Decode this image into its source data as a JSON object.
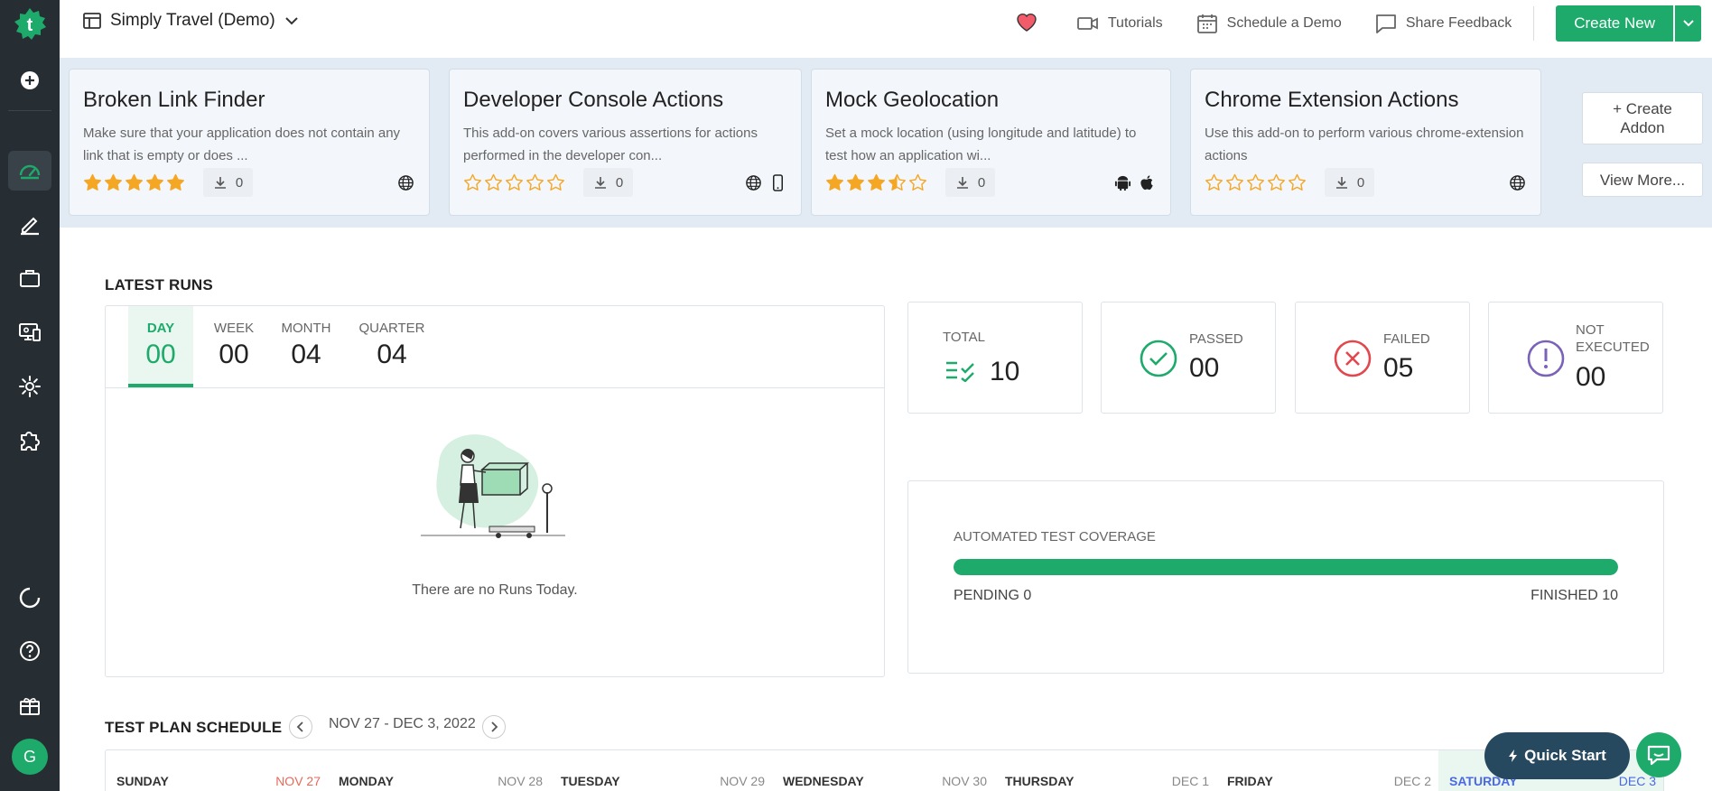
{
  "colors": {
    "brand": "#1eaa6b",
    "sidebar": "#262d33",
    "star": "#f5a623",
    "failed": "#e2474e",
    "not_executed": "#7a62b8",
    "quick_start": "#27495f"
  },
  "sidebar": {
    "avatar_initial": "G"
  },
  "header": {
    "project": "Simply Travel (Demo)",
    "tutorials": "Tutorials",
    "schedule_demo": "Schedule a Demo",
    "share_feedback": "Share Feedback",
    "create_new": "Create New"
  },
  "addons": [
    {
      "title": "Broken Link Finder",
      "desc": "Make sure that your application does not contain any link that is empty or does ...",
      "rating": 5,
      "downloads": "0",
      "platforms": [
        "globe-icon"
      ]
    },
    {
      "title": "Developer Console Actions",
      "desc": "This add-on covers various assertions for actions performed in the developer con...",
      "rating": 0,
      "downloads": "0",
      "platforms": [
        "globe-icon",
        "mobile-icon"
      ]
    },
    {
      "title": "Mock Geolocation",
      "desc": "Set a mock location (using longitude and latitude) to test how an application wi...",
      "rating": 3.5,
      "downloads": "0",
      "platforms": [
        "android-icon",
        "apple-icon"
      ]
    },
    {
      "title": "Chrome Extension Actions",
      "desc": "Use this add-on to perform various chrome-extension actions",
      "rating": 0,
      "downloads": "0",
      "platforms": [
        "globe-icon"
      ]
    }
  ],
  "addon_actions": {
    "create": "+ Create Addon",
    "view_more": "View More..."
  },
  "latest_runs": {
    "title": "LATEST RUNS",
    "tabs": [
      {
        "label": "DAY",
        "value": "00"
      },
      {
        "label": "WEEK",
        "value": "00"
      },
      {
        "label": "MONTH",
        "value": "04"
      },
      {
        "label": "QUARTER",
        "value": "04"
      }
    ],
    "empty_text": "There are no Runs Today."
  },
  "stats": {
    "total": {
      "label": "TOTAL",
      "value": "10"
    },
    "passed": {
      "label": "PASSED",
      "value": "00"
    },
    "failed": {
      "label": "FAILED",
      "value": "05"
    },
    "not_executed": {
      "label": "NOT EXECUTED",
      "value": "00"
    }
  },
  "coverage": {
    "title": "AUTOMATED TEST COVERAGE",
    "pending": "PENDING 0",
    "finished": "FINISHED 10",
    "fraction": 1.0
  },
  "schedule": {
    "title": "TEST PLAN SCHEDULE",
    "range": "NOV 27 - DEC 3, 2022",
    "days": [
      {
        "name": "SUNDAY",
        "date": "NOV 27"
      },
      {
        "name": "MONDAY",
        "date": "NOV 28"
      },
      {
        "name": "TUESDAY",
        "date": "NOV 29"
      },
      {
        "name": "WEDNESDAY",
        "date": "NOV 30"
      },
      {
        "name": "THURSDAY",
        "date": "DEC 1"
      },
      {
        "name": "FRIDAY",
        "date": "DEC 2"
      },
      {
        "name": "SATURDAY",
        "date": "DEC 3"
      }
    ]
  },
  "quick_start": "Quick Start"
}
